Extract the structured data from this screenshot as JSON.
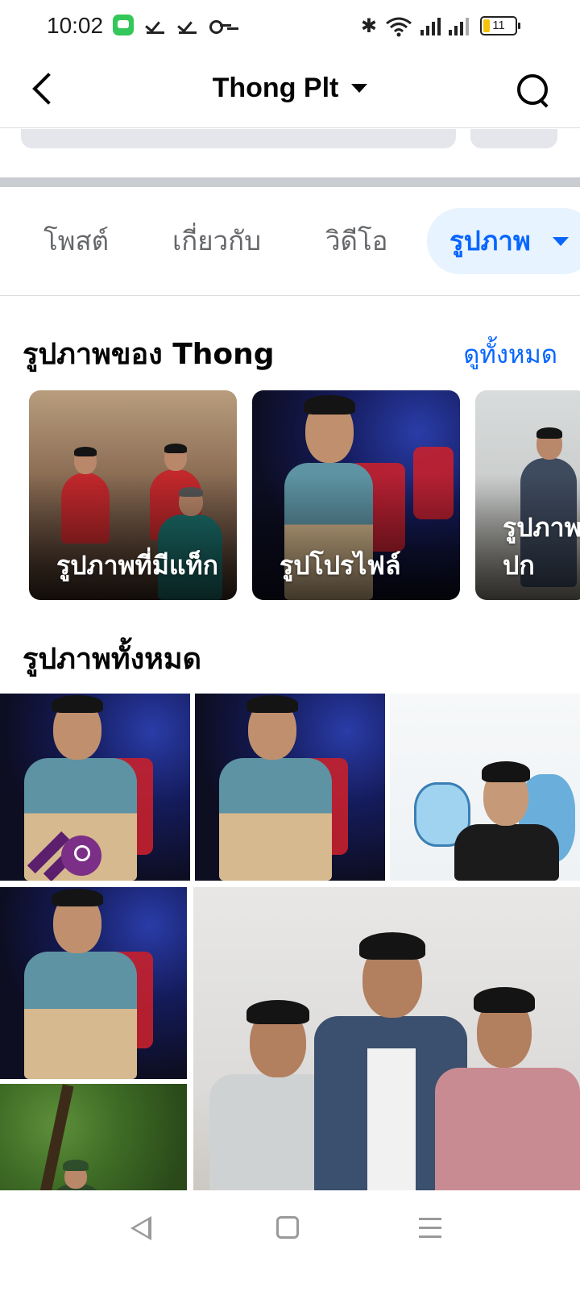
{
  "status_bar": {
    "time": "10:02",
    "battery": "11",
    "icons": [
      "message-icon",
      "check-icon",
      "check-icon",
      "key-icon",
      "bluetooth-icon",
      "wifi-icon",
      "signal-icon",
      "signal-icon",
      "battery-icon"
    ]
  },
  "header": {
    "title": "Thong Plt",
    "back_icon": "back-arrow-icon",
    "dropdown_icon": "caret-down-icon",
    "search_icon": "search-icon"
  },
  "tabs": [
    {
      "label": "โพสต์",
      "active": false
    },
    {
      "label": "เกี่ยวกับ",
      "active": false
    },
    {
      "label": "วิดีโอ",
      "active": false
    },
    {
      "label": "รูปภาพ",
      "active": true
    }
  ],
  "albums_section": {
    "title": "รูปภาพของ Thong",
    "see_all": "ดูทั้งหมด",
    "albums": [
      {
        "label": "รูปภาพที่มีแท็ก"
      },
      {
        "label": "รูปโปรไฟล์"
      },
      {
        "label": "รูปภาพปก"
      }
    ]
  },
  "all_photos_section": {
    "title": "รูปภาพทั้งหมด"
  },
  "colors": {
    "accent": "#0866ff",
    "accent_bg": "#e7f3ff",
    "text_secondary": "#65676b",
    "divider": "#dadde1"
  },
  "nav_bar": {
    "icons": [
      "nav-back-icon",
      "nav-home-icon",
      "nav-menu-icon"
    ]
  }
}
